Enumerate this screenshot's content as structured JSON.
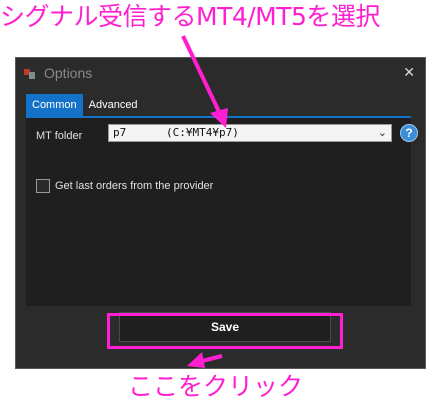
{
  "annotations": {
    "top_text": "シグナル受信するMT4/MT5を選択",
    "bottom_text": "ここをクリック",
    "color": "#ff1fd0"
  },
  "window": {
    "title": "Options",
    "close_glyph": "✕",
    "tabs": [
      {
        "label": "Common",
        "active": true
      },
      {
        "label": "Advanced",
        "active": false
      }
    ],
    "mt_folder": {
      "label": "MT folder",
      "value": "p7      (C:¥MT4¥p7)",
      "chevron": "⌄",
      "help_glyph": "?"
    },
    "checkbox": {
      "label": "Get last orders from the provider",
      "checked": false
    },
    "save_label": "Save",
    "accent_color": "#1473c8"
  },
  "icons": [
    "app-icon",
    "close-icon",
    "chevron-down-icon",
    "help-icon"
  ]
}
